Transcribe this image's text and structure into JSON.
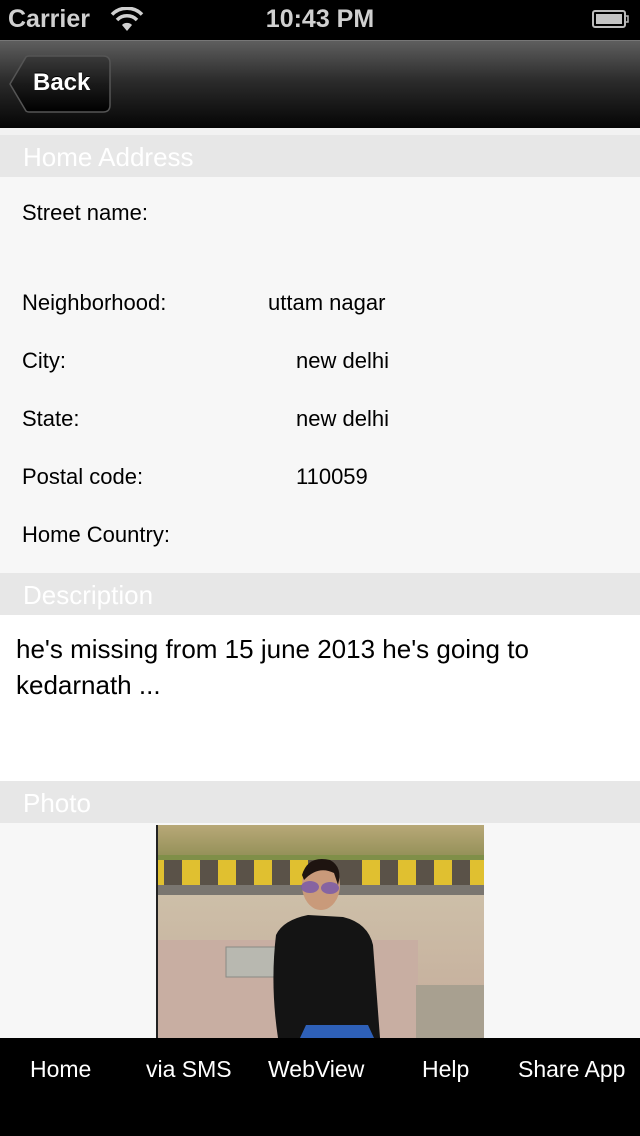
{
  "status_bar": {
    "carrier": "Carrier",
    "time": "10:43 PM",
    "wifi_icon": "wifi-icon",
    "battery_icon": "battery-icon"
  },
  "nav_bar": {
    "back_label": "Back"
  },
  "sections": {
    "home_address": {
      "title": "Home Address",
      "fields": [
        {
          "label": "Street name:",
          "value": ""
        },
        {
          "label": "Neighborhood:",
          "value": "uttam nagar"
        },
        {
          "label": "City:",
          "value": "new delhi"
        },
        {
          "label": "State:",
          "value": "new delhi"
        },
        {
          "label": "Postal code:",
          "value": "110059"
        },
        {
          "label": "Home Country:",
          "value": ""
        }
      ]
    },
    "description": {
      "title": "Description",
      "text": "he's missing  from 15 june 2013  he's going to kedarnath ..."
    },
    "photo": {
      "title": "Photo",
      "alt": "Photo of man in black shirt and sunglasses sitting on a stone wall"
    }
  },
  "tab_bar": {
    "items": [
      {
        "label": "Home"
      },
      {
        "label": "via SMS"
      },
      {
        "label": "WebView"
      },
      {
        "label": "Help"
      },
      {
        "label": "Share App"
      }
    ]
  },
  "colors": {
    "section_header_bg": "#e7e7e7",
    "content_bg": "#f7f7f7",
    "tab_bar_bg": "#000000"
  }
}
